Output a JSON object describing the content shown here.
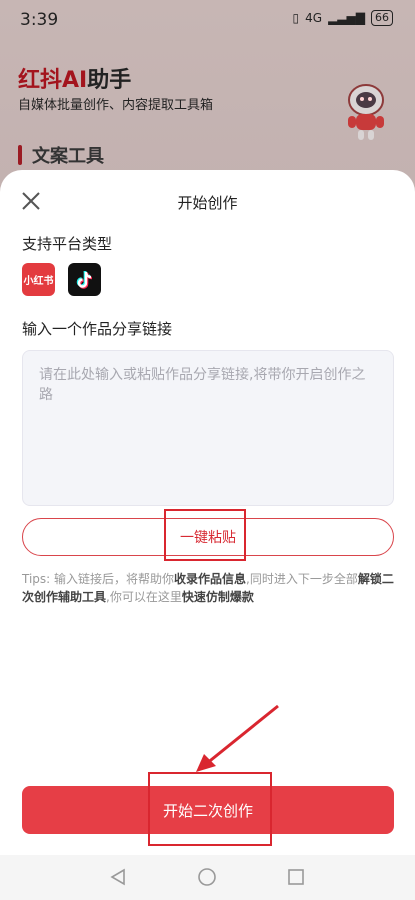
{
  "status": {
    "time": "3:39",
    "network": "4G",
    "battery": "66"
  },
  "app": {
    "title_red": "红抖AI",
    "title_rest": "助手",
    "subtitle": "自媒体批量创作、内容提取工具箱",
    "section_title": "文案工具"
  },
  "sheet": {
    "title": "开始创作",
    "platforms_label": "支持平台类型",
    "platforms": [
      "小红书",
      "douyin-icon"
    ],
    "link_label": "输入一个作品分享链接",
    "link_input": {
      "value": "",
      "placeholder": "请在此处输入或粘贴作品分享链接,将带你开启创作之路"
    },
    "paste_button": "一键粘贴",
    "tips": {
      "t1": "Tips: 输入链接后，将帮助你",
      "b1": "收录作品信息",
      "t2": ",同时进入下一步全部",
      "b2": "解锁二次创作辅助工具",
      "t3": ",你可以在这里",
      "b3": "快速仿制爆款"
    },
    "start_button": "开始二次创作"
  },
  "colors": {
    "accent": "#e63e46",
    "brand_dark": "#a3141d",
    "annotation": "#d9262f"
  }
}
